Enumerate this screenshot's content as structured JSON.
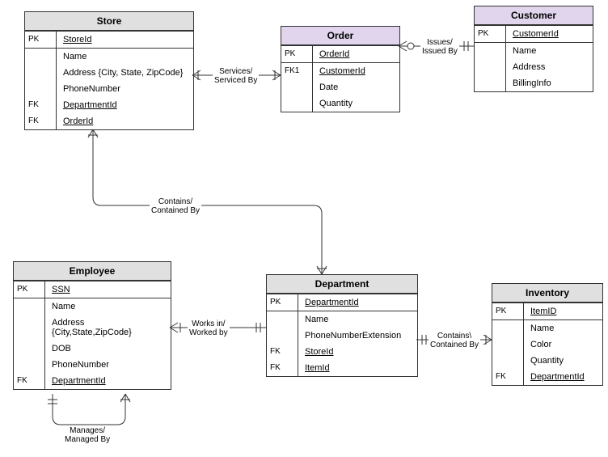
{
  "entities": {
    "store": {
      "title": "Store",
      "pk": "PK",
      "storeId": "StoreId",
      "name": "Name",
      "address": "Address {City, State, ZipCode}",
      "phoneNumber": "PhoneNumber",
      "fk1": "FK",
      "departmentId": "DepartmentId",
      "fk2": "FK",
      "orderId": "OrderId"
    },
    "order": {
      "title": "Order",
      "pk": "PK",
      "orderId": "OrderId",
      "fk1": "FK1",
      "customerId": "CustomerId",
      "date": "Date",
      "quantity": "Quantity"
    },
    "customer": {
      "title": "Customer",
      "pk": "PK",
      "customerId": "CustomerId",
      "name": "Name",
      "address": "Address",
      "billingInfo": "BillingInfo"
    },
    "employee": {
      "title": "Employee",
      "pk": "PK",
      "ssn": "SSN",
      "name": "Name",
      "address": "Address {City,State,ZipCode}",
      "dob": "DOB",
      "phoneNumber": "PhoneNumber",
      "fk": "FK",
      "departmentId": "DepartmentId"
    },
    "department": {
      "title": "Department",
      "pk": "PK",
      "departmentId": "DepartmentId",
      "name": "Name",
      "phoneNumberExtension": "PhoneNumberExtension",
      "fk1": "FK",
      "storeId": "StoreId",
      "fk2": "FK",
      "itemId": "ItemId"
    },
    "inventory": {
      "title": "Inventory",
      "pk": "PK",
      "itemId": "ItemID",
      "name": "Name",
      "color": "Color",
      "quantity": "Quantity",
      "fk": "FK",
      "departmentId": "DepartmentId"
    }
  },
  "relationships": {
    "servicesServicedBy": "Services/\nServiced By",
    "issuesIssuedBy": "Issues/\nIssued By",
    "containsContainedBy1": "Contains/\nContained By",
    "worksInWorkedBy": "Works in/\nWorked by",
    "containsContainedBy2": "Contains\\\nContained By",
    "managesManagedBy": "Manages/\nManaged By"
  }
}
